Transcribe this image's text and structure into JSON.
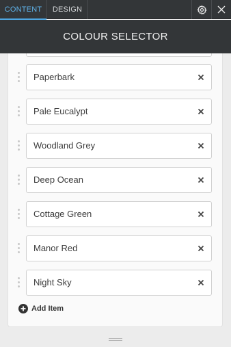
{
  "tabs": {
    "content": "CONTENT",
    "design": "DESIGN"
  },
  "icons": {
    "settings": "gear-icon",
    "close": "close-icon",
    "drag": "drag-handle-icon",
    "remove": "remove-x-icon",
    "add": "plus-circle-icon",
    "resize": "resize-grip-icon"
  },
  "header": {
    "title": "COLOUR SELECTOR"
  },
  "items": [
    {
      "label": "Paperbark"
    },
    {
      "label": "Pale Eucalypt"
    },
    {
      "label": "Woodland Grey"
    },
    {
      "label": "Deep Ocean"
    },
    {
      "label": "Cottage Green"
    },
    {
      "label": "Manor Red"
    },
    {
      "label": "Night Sky"
    }
  ],
  "add_item_label": "Add Item",
  "colors": {
    "accent": "#4ea6e0",
    "topbar": "#333638",
    "panel": "#fafafa"
  }
}
